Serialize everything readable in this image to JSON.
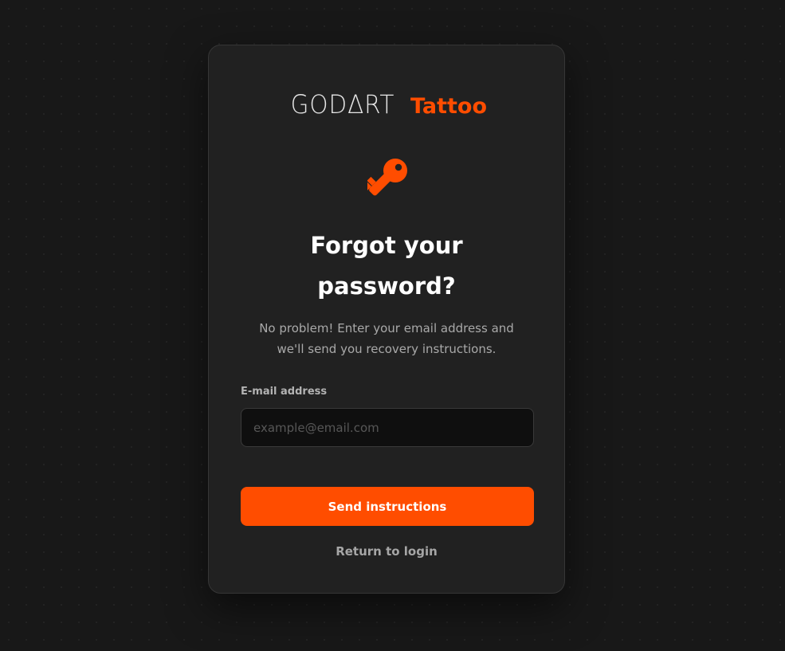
{
  "brand": {
    "name": "GODΔRT",
    "suffix": "Tattoo",
    "accent_color": "#ff4d00"
  },
  "icon": {
    "name": "key-icon"
  },
  "heading": {
    "line1": "Forgot your",
    "line2": "password?"
  },
  "description": {
    "line1": "No problem! Enter your email address and",
    "line2": "we'll send you recovery instructions."
  },
  "form": {
    "email_label": "E-mail address",
    "email_placeholder": "example@email.com",
    "email_value": "",
    "submit_label": "Send instructions"
  },
  "footer": {
    "return_label": "Return to login"
  }
}
